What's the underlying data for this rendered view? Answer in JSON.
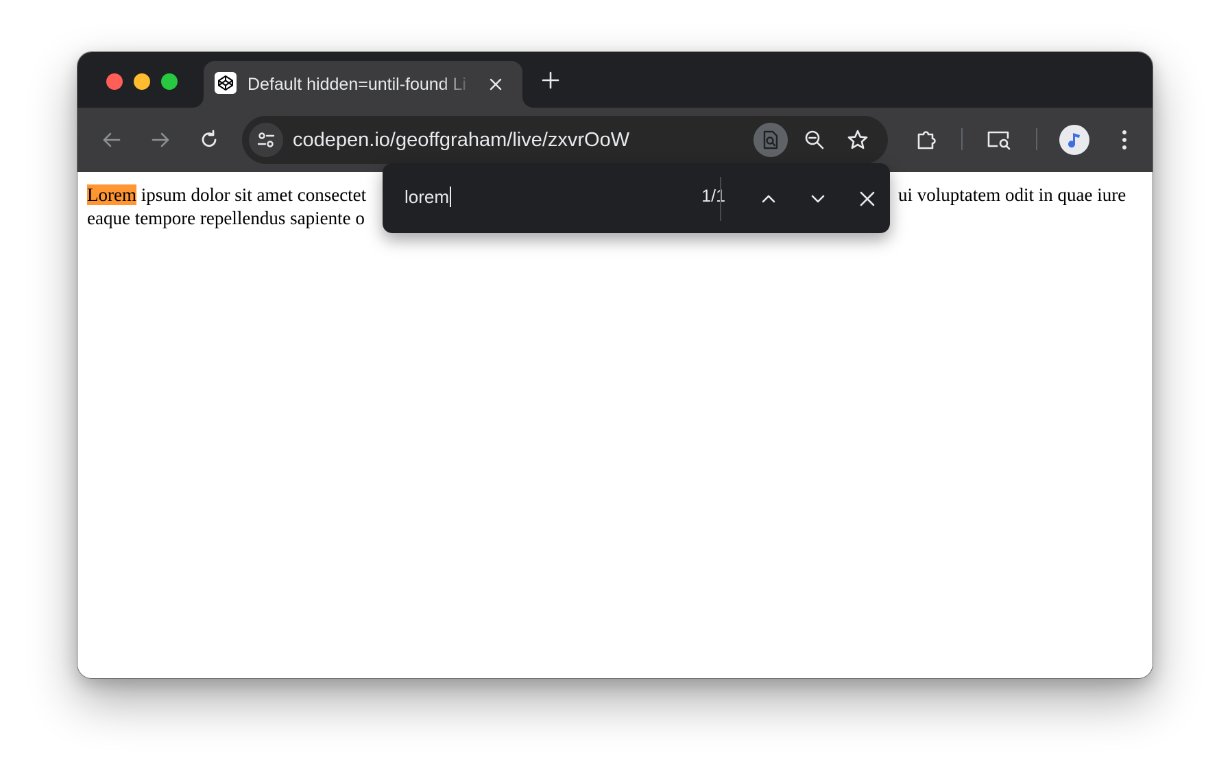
{
  "tab": {
    "title": "Default hidden=until-found Li",
    "favicon": "codepen-logo-icon"
  },
  "toolbar": {
    "url": "codepen.io/geoffgraham/live/zxvrOoW"
  },
  "find_bar": {
    "query": "lorem",
    "count": "1/1"
  },
  "page": {
    "line1_highlight": "Lorem",
    "line1_left": " ipsum dolor sit amet consectet",
    "line1_right": "ui voluptatem odit in quae iure",
    "line2_left": "eaque tempore repellendus sapiente o"
  },
  "colors": {
    "tabstrip": "#202124",
    "toolbar": "#3c3c3f",
    "omnibox": "#282828",
    "find_bar": "#202124",
    "match_highlight": "#ff9632",
    "traffic_red": "#ff5f57",
    "traffic_yellow": "#febc2e",
    "traffic_green": "#28c840"
  },
  "icons": [
    "back-arrow-icon",
    "forward-arrow-icon",
    "reload-icon",
    "site-settings-icon",
    "find-in-page-icon",
    "zoom-icon",
    "bookmark-star-icon",
    "extensions-icon",
    "cast-search-icon",
    "music-note-icon",
    "more-vert-icon",
    "chevron-up-icon",
    "chevron-down-icon",
    "close-icon",
    "plus-icon"
  ]
}
